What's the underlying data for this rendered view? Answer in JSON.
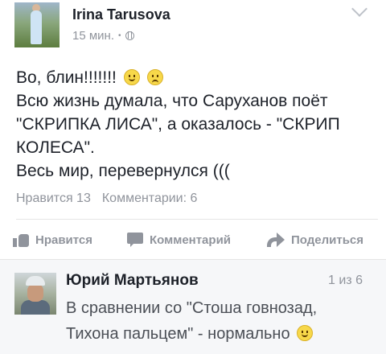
{
  "post": {
    "author": "Irina Tarusova",
    "time": "15 мин.",
    "separator": "•",
    "text_lines": [
      "Во, блин!!!!!!!",
      "Всю жизнь думала, что Саруханов поёт",
      "\"СКРИПКА ЛИСА\", а оказалось - \"СКРИП",
      "КОЛЕСА\".",
      "Весь мир, перевернулся ((("
    ],
    "likes": "Нравится 13",
    "comments": "Комментарии: 6"
  },
  "actions": {
    "like": "Нравится",
    "comment": "Комментарий",
    "share": "Поделиться"
  },
  "comment": {
    "author": "Юрий Мартьянов",
    "position": "1 из 6",
    "text_lines": [
      "В сравнении со \"Стоша говнозад,",
      "Тихона пальцем\" - нормально"
    ]
  },
  "icons": {
    "privacy": "globe-icon",
    "menu": "chevron-down-icon",
    "like": "thumbs-up-icon",
    "comment": "speech-bubble-icon",
    "share": "share-arrow-icon"
  }
}
